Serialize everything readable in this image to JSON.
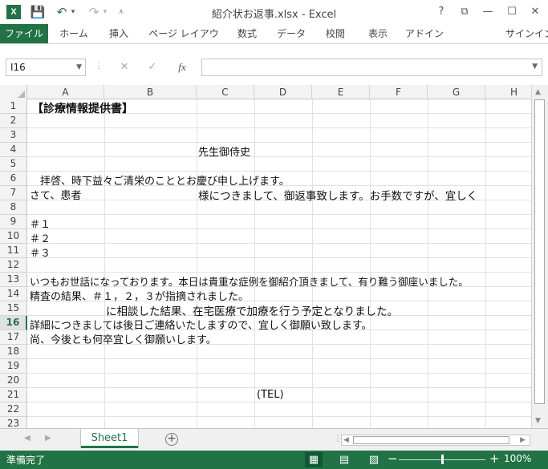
{
  "window": {
    "title": "紹介状お返事.xlsx - Excel",
    "app_icon": "X",
    "help": "?",
    "restore_ribbon": "⧉",
    "minimize": "—",
    "maximize": "☐",
    "close": "✕"
  },
  "quick_access": {
    "save": "💾",
    "undo": "↶",
    "redo": "↷",
    "customize": "⩡"
  },
  "ribbon": {
    "tabs": [
      "ファイル",
      "ホーム",
      "挿入",
      "ページ レイアウト",
      "数式",
      "データ",
      "校閲",
      "表示",
      "アドイン"
    ],
    "signin": "サインイン"
  },
  "formula_bar": {
    "name_box": "I16",
    "cancel": "✕",
    "enter": "✓",
    "fx": "fx",
    "value": ""
  },
  "grid": {
    "columns": [
      "A",
      "B",
      "C",
      "D",
      "E",
      "F",
      "G",
      "H"
    ],
    "rows": [
      "1",
      "2",
      "3",
      "4",
      "5",
      "6",
      "7",
      "8",
      "9",
      "10",
      "11",
      "12",
      "13",
      "14",
      "15",
      "16",
      "17",
      "18",
      "19",
      "20",
      "21",
      "22",
      "23"
    ],
    "selected_row": "16",
    "cells": {
      "r1": "【診療情報提供書】",
      "r4": "先生御侍史",
      "r6": "拝啓、時下益々ご清栄のこととお慶び申し上げます。",
      "r7a": "さて、患者",
      "r7c": "様につきまして、御返事致します。お手数ですが、宜しく",
      "r9": "＃１",
      "r10": "＃２",
      "r11": "＃３",
      "r13": "いつもお世話になっております。本日は貴重な症例を御紹介頂きまして、有り難う御座いました。",
      "r14": "精査の結果、＃１，２，３が指摘されました。",
      "r15": "に相談した結果、在宅医療で加療を行う予定となりました。",
      "r16": "詳細につきましては後日ご連絡いたしますので、宜しく御願い致します。",
      "r17": "尚、今後とも何卒宜しく御願いします。",
      "r21": "(TEL)"
    }
  },
  "sheets": {
    "tabs": [
      "Sheet1"
    ],
    "add": "+",
    "prev": "◀",
    "next": "▶"
  },
  "status": {
    "text": "準備完了",
    "zoom_minus": "−",
    "zoom_plus": "+",
    "zoom": "100%",
    "zoom_fraction": 0.5
  }
}
